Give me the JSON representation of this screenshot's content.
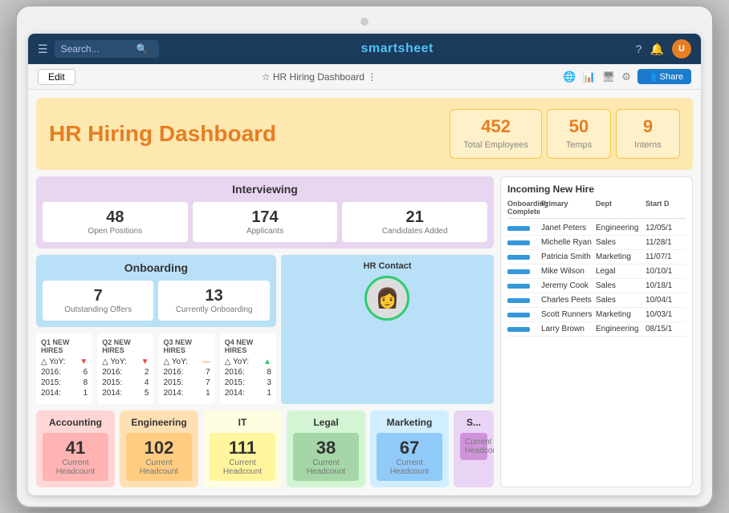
{
  "app": {
    "name_prefix": "smart",
    "name_suffix": "sheet"
  },
  "nav": {
    "search_placeholder": "Search...",
    "title": "smartsheet",
    "help_icon": "?",
    "bell_icon": "🔔"
  },
  "toolbar": {
    "edit_label": "Edit",
    "dashboard_title": "☆  HR Hiring Dashboard  ⋮",
    "share_label": "Share"
  },
  "hero": {
    "title_hr": "HR",
    "title_rest": " Hiring Dashboard",
    "stats": [
      {
        "number": "452",
        "label": "Total Employees"
      },
      {
        "number": "50",
        "label": "Temps"
      },
      {
        "number": "9",
        "label": "Interns"
      }
    ]
  },
  "interviewing": {
    "title": "Interviewing",
    "stats": [
      {
        "number": "48",
        "label": "Open Positions"
      },
      {
        "number": "174",
        "label": "Applicants"
      },
      {
        "number": "21",
        "label": "Candidates Added"
      }
    ]
  },
  "onboarding": {
    "title": "Onboarding",
    "stats": [
      {
        "number": "7",
        "label": "Outstanding Offers"
      },
      {
        "number": "13",
        "label": "Currently Onboarding"
      }
    ]
  },
  "yoy": [
    {
      "title": "Q1 NEW HIRES",
      "delta_label": "△ YoY:",
      "delta_dir": "down",
      "rows": [
        {
          "year": "2016:",
          "val": "6"
        },
        {
          "year": "2015:",
          "val": "8"
        },
        {
          "year": "2014:",
          "val": "1"
        }
      ]
    },
    {
      "title": "Q2 NEW HIRES",
      "delta_label": "△ YoY:",
      "delta_dir": "down",
      "rows": [
        {
          "year": "2016:",
          "val": "2"
        },
        {
          "year": "2015:",
          "val": "4"
        },
        {
          "year": "2014:",
          "val": "5"
        }
      ]
    },
    {
      "title": "Q3 NEW HIRES",
      "delta_label": "△ YoY:",
      "delta_dir": "flat",
      "rows": [
        {
          "year": "2016:",
          "val": "7"
        },
        {
          "year": "2015:",
          "val": "7"
        },
        {
          "year": "2014:",
          "val": "1"
        }
      ]
    },
    {
      "title": "Q4 NEW HIRES",
      "delta_label": "△ YoY:",
      "delta_dir": "up",
      "rows": [
        {
          "year": "2016:",
          "val": "8"
        },
        {
          "year": "2015:",
          "val": "3"
        },
        {
          "year": "2014:",
          "val": "1"
        }
      ]
    }
  ],
  "hr_contact": {
    "title": "HR Contact",
    "icon": "👩"
  },
  "incoming_table": {
    "title": "Incoming New Hire",
    "columns": [
      "Onboarding Complete",
      "Primary",
      "Dept",
      "Start D"
    ],
    "rows": [
      {
        "bar": true,
        "name": "Janet Peters",
        "dept": "Engineering",
        "start": "12/05/1"
      },
      {
        "bar": true,
        "name": "Michelle Ryan",
        "dept": "Sales",
        "start": "11/28/1"
      },
      {
        "bar": true,
        "name": "Patricia Smith",
        "dept": "Marketing",
        "start": "11/07/1"
      },
      {
        "bar": true,
        "name": "Mike Wilson",
        "dept": "Legal",
        "start": "10/10/1"
      },
      {
        "bar": true,
        "name": "Jeremy Cook",
        "dept": "Sales",
        "start": "10/18/1"
      },
      {
        "bar": true,
        "name": "Charles Peets",
        "dept": "Sales",
        "start": "10/04/1"
      },
      {
        "bar": true,
        "name": "Scott Runners",
        "dept": "Marketing",
        "start": "10/03/1"
      },
      {
        "bar": true,
        "name": "Larry Brown",
        "dept": "Engineering",
        "start": "08/15/1"
      }
    ]
  },
  "departments": [
    {
      "name": "Accounting",
      "count": "41",
      "label": "Current Headcount",
      "class": "dept-accounting"
    },
    {
      "name": "Engineering",
      "count": "102",
      "label": "Current Headcount",
      "class": "dept-engineering"
    },
    {
      "name": "IT",
      "count": "111",
      "label": "Current Headcount",
      "class": "dept-it"
    },
    {
      "name": "Legal",
      "count": "38",
      "label": "Current Headcount",
      "class": "dept-legal"
    },
    {
      "name": "Marketing",
      "count": "67",
      "label": "Current Headcount",
      "class": "dept-marketing"
    },
    {
      "name": "S...",
      "count": "...",
      "label": "Current Headcount",
      "class": "dept-extra"
    }
  ]
}
